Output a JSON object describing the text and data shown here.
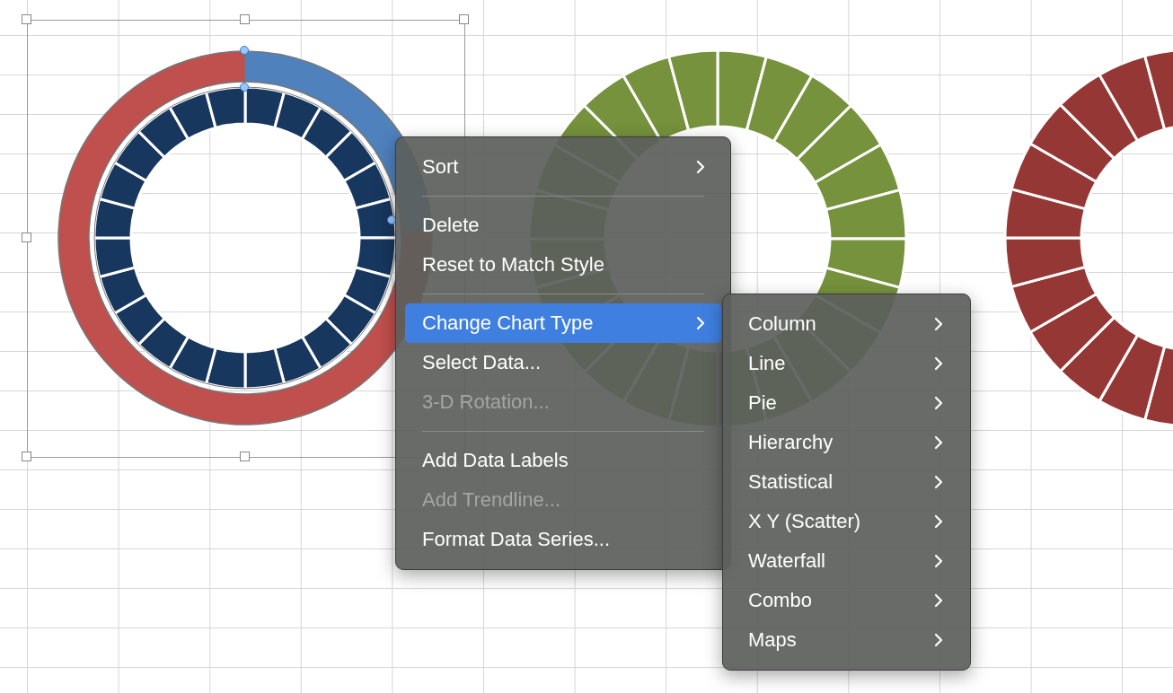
{
  "charts": [
    {
      "selected": true
    },
    {
      "selected": false
    },
    {
      "selected": false
    }
  ],
  "context_menu": {
    "items": [
      {
        "kind": "item",
        "label": "Sort",
        "disabled": false,
        "selected": false,
        "has_submenu": true
      },
      {
        "kind": "separator"
      },
      {
        "kind": "item",
        "label": "Delete",
        "disabled": false,
        "selected": false,
        "has_submenu": false
      },
      {
        "kind": "item",
        "label": "Reset to Match Style",
        "disabled": false,
        "selected": false,
        "has_submenu": false
      },
      {
        "kind": "separator"
      },
      {
        "kind": "item",
        "label": "Change Chart Type",
        "disabled": false,
        "selected": true,
        "has_submenu": true
      },
      {
        "kind": "item",
        "label": "Select Data...",
        "disabled": false,
        "selected": false,
        "has_submenu": false
      },
      {
        "kind": "item",
        "label": "3-D Rotation...",
        "disabled": true,
        "selected": false,
        "has_submenu": false
      },
      {
        "kind": "separator"
      },
      {
        "kind": "item",
        "label": "Add Data Labels",
        "disabled": false,
        "selected": false,
        "has_submenu": false
      },
      {
        "kind": "item",
        "label": "Add Trendline...",
        "disabled": true,
        "selected": false,
        "has_submenu": false
      },
      {
        "kind": "item",
        "label": "Format Data Series...",
        "disabled": false,
        "selected": false,
        "has_submenu": false
      }
    ]
  },
  "submenu": {
    "items": [
      {
        "label": "Column",
        "has_submenu": true
      },
      {
        "label": "Line",
        "has_submenu": true
      },
      {
        "label": "Pie",
        "has_submenu": true
      },
      {
        "label": "Hierarchy",
        "has_submenu": true
      },
      {
        "label": "Statistical",
        "has_submenu": true
      },
      {
        "label": "X Y (Scatter)",
        "has_submenu": true
      },
      {
        "label": "Waterfall",
        "has_submenu": true
      },
      {
        "label": "Combo",
        "has_submenu": true
      },
      {
        "label": "Maps",
        "has_submenu": true
      }
    ]
  }
}
